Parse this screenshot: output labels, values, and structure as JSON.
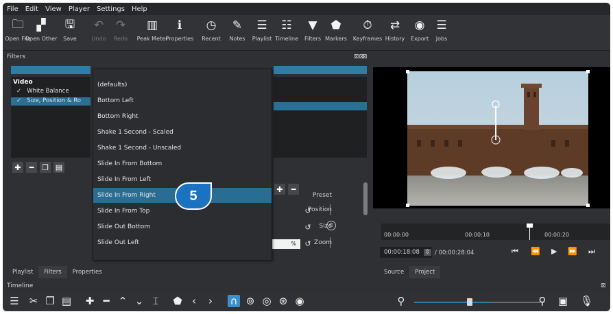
{
  "menu": [
    "File",
    "Edit",
    "View",
    "Player",
    "Settings",
    "Help"
  ],
  "toolbar": [
    {
      "label": "Open File",
      "icon": "folder-icon",
      "glyph": "🗀",
      "dim": false
    },
    {
      "label": "Open Other",
      "icon": "open-other-icon",
      "glyph": "▞",
      "dim": false
    },
    {
      "label": "Save",
      "icon": "save-icon",
      "glyph": "🖫",
      "dim": false
    },
    {
      "label": "Undo",
      "icon": "undo-icon",
      "glyph": "↶",
      "dim": true
    },
    {
      "label": "Redo",
      "icon": "redo-icon",
      "glyph": "↷",
      "dim": true
    },
    {
      "label": "Peak Meter",
      "icon": "peak-meter-icon",
      "glyph": "▥",
      "dim": false
    },
    {
      "label": "Properties",
      "icon": "info-icon",
      "glyph": "ℹ",
      "dim": false
    },
    {
      "label": "Recent",
      "icon": "clock-icon",
      "glyph": "◷",
      "dim": false
    },
    {
      "label": "Notes",
      "icon": "notes-icon",
      "glyph": "✎",
      "dim": false
    },
    {
      "label": "Playlist",
      "icon": "playlist-icon",
      "glyph": "☰",
      "dim": false
    },
    {
      "label": "Timeline",
      "icon": "timeline-icon",
      "glyph": "☷",
      "dim": false
    },
    {
      "label": "Filters",
      "icon": "filter-icon",
      "glyph": "▼",
      "dim": false
    },
    {
      "label": "Markers",
      "icon": "marker-icon",
      "glyph": "⬟",
      "dim": false
    },
    {
      "label": "Keyframes",
      "icon": "stopwatch-icon",
      "glyph": "⏱",
      "dim": false
    },
    {
      "label": "History",
      "icon": "history-icon",
      "glyph": "⇄",
      "dim": false
    },
    {
      "label": "Export",
      "icon": "export-icon",
      "glyph": "◉",
      "dim": false
    },
    {
      "label": "Jobs",
      "icon": "jobs-icon",
      "glyph": "☰",
      "dim": false
    }
  ],
  "filters_panel": {
    "title": "Filters",
    "list_header": "Video",
    "items": [
      {
        "check": "✓",
        "label": "White Balance"
      },
      {
        "check": "✓",
        "label": "Size, Position & Ro"
      }
    ],
    "labels": {
      "preset": "Preset",
      "position": "Position",
      "size": "Size",
      "zoom": "Zoom"
    },
    "zoom_value": "%"
  },
  "preset_dropdown": [
    "(defaults)",
    "Bottom Left",
    "Bottom Right",
    "Shake 1 Second - Scaled",
    "Shake 1 Second - Unscaled",
    "Slide In From Bottom",
    "Slide In From Left",
    "Slide In From Right",
    "Slide In From Top",
    "Slide Out Bottom",
    "Slide Out Left"
  ],
  "highlighted_index": 7,
  "callout_number": "5",
  "left_tabs": [
    "Playlist",
    "Filters",
    "Properties"
  ],
  "right_tabs": [
    "Source",
    "Project"
  ],
  "player": {
    "ruler_ticks": [
      "00:00:00",
      "00:00:10",
      "00:00:20"
    ],
    "current_time": "00:00:18:08",
    "total_time": "/ 00:00:28:04"
  },
  "timeline": {
    "title": "Timeline"
  },
  "colors": {
    "accent": "#2b7ea8",
    "badge": "#1a72c0",
    "background": "#2f3033"
  }
}
